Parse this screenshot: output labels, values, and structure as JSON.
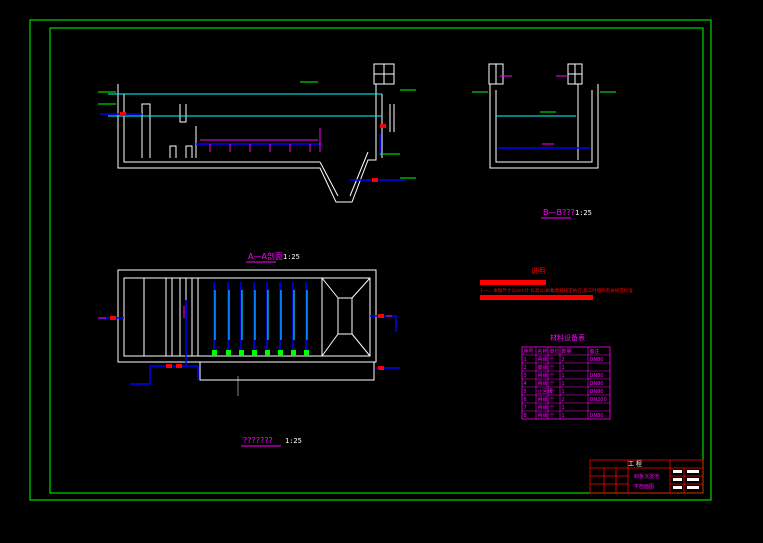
{
  "colors": {
    "background": "#000000",
    "border": "#00ff00",
    "structure": "#ffffff",
    "pipe": "#0000ff",
    "water": "#00ffff",
    "note": "#ff00ff",
    "accent": "#ff0000",
    "level": "#00ff00"
  },
  "views": {
    "section_a": {
      "title": "A—A剖面",
      "scale": "1:25"
    },
    "section_b": {
      "title": "B—B???",
      "scale": "1:25"
    },
    "plan": {
      "title": "???????",
      "scale": "1:25"
    }
  },
  "notes": {
    "heading": "说明",
    "line1": "1.一、本图尺寸以mm计,标高以m计。",
    "line2": "2.本图按规定执行,施工时遵照有关规范标准"
  },
  "material_table": {
    "title": "材料设备表",
    "headers": [
      "序号",
      "名称",
      "单位",
      "数量",
      "备注"
    ],
    "rows": [
      [
        "1",
        "闸阀",
        "个",
        "2",
        "DN80"
      ],
      [
        "2",
        "蝶阀",
        "个",
        "1",
        ""
      ],
      [
        "3",
        "闸阀",
        "个",
        "1",
        "DN80"
      ],
      [
        "4",
        "闸阀",
        "个",
        "1",
        "DN80"
      ],
      [
        "5",
        "止回阀",
        "个",
        "1",
        "DN80"
      ],
      [
        "6",
        "闸阀",
        "个",
        "2",
        "DN200"
      ],
      [
        "7",
        "闸阀",
        "个",
        "1",
        ""
      ],
      [
        "8",
        "闸阀",
        "个",
        "1",
        "DN80"
      ]
    ]
  },
  "title_block": {
    "project": "斜板沉淀池",
    "drawing_name": "平剖面图",
    "header": "工 程"
  }
}
